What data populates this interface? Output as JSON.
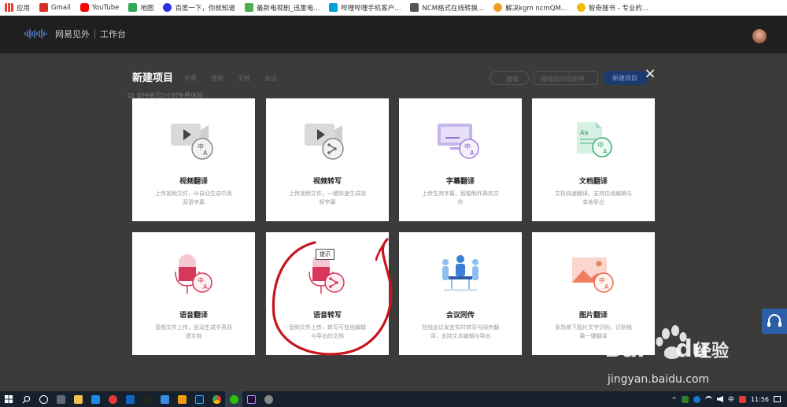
{
  "bookmarks": [
    {
      "label": "应用",
      "color": "#e94235"
    },
    {
      "label": "Gmail",
      "color": "#d93025"
    },
    {
      "label": "YouTube",
      "color": "#ff0000"
    },
    {
      "label": "地图",
      "color": "#34a853"
    },
    {
      "label": "百度一下，你就知道",
      "color": "#2932e1"
    },
    {
      "label": "最新电视剧_迅雷电...",
      "color": "#4caf50"
    },
    {
      "label": "哔哩哔哩手机客户...",
      "color": "#00a1d6"
    },
    {
      "label": "NCM格式在线转换...",
      "color": "#555555"
    },
    {
      "label": "解决kgm ncmQM...",
      "color": "#f0a020"
    },
    {
      "label": "智奇搜书 - 专业的...",
      "color": "#f5b800"
    }
  ],
  "app": {
    "brand": "网易见外",
    "workspace": "工作台"
  },
  "background": {
    "tabs": [
      "字幕",
      "音频",
      "文档",
      "会议"
    ],
    "search": "搜索",
    "sort": "按修改时间排序",
    "new_project": "新建项目"
  },
  "modal": {
    "title": "新建项目",
    "subtitle": "Qi 支持每日2小时免费体验...",
    "close": "×",
    "cards": [
      {
        "title": "视频翻译",
        "desc": "上传视频文件，AI自动生成中英双语字幕",
        "icon": "video-translate-icon"
      },
      {
        "title": "视频转写",
        "desc": "上传视频文件，一键快速生成视频字幕",
        "icon": "video-transcribe-icon"
      },
      {
        "title": "字幕翻译",
        "desc": "上传生肉字幕，智能制作熟肉文件",
        "icon": "subtitle-translate-icon"
      },
      {
        "title": "文档翻译",
        "desc": "文档快速翻译，支持在线编辑与本地导出",
        "icon": "document-translate-icon"
      },
      {
        "title": "语音翻译",
        "desc": "音频文件上传，自动生成中英双语文档",
        "icon": "voice-translate-icon"
      },
      {
        "title": "语音转写",
        "desc": "音频文件上传，转写可在线编辑与导出的文档",
        "icon": "voice-transcribe-icon"
      },
      {
        "title": "会议同传",
        "desc": "在线会议发言实时转写与同步翻译，支持文本编辑与导出",
        "icon": "meeting-interpret-icon"
      },
      {
        "title": "图片翻译",
        "desc": "多场景下图片文字识别，识别结果一键翻译",
        "icon": "image-translate-icon"
      }
    ],
    "tooltip": "提示"
  },
  "watermark": {
    "brand": "Bai",
    "brand2": "du",
    "cn": "经验",
    "url": "jingyan.baidu.com"
  },
  "taskbar": {
    "ime": "中",
    "time": "11:56"
  },
  "colors": {
    "accent_blue": "#2d5fa8",
    "annotation_red": "#c8141e",
    "card_bg": "#ffffff"
  }
}
